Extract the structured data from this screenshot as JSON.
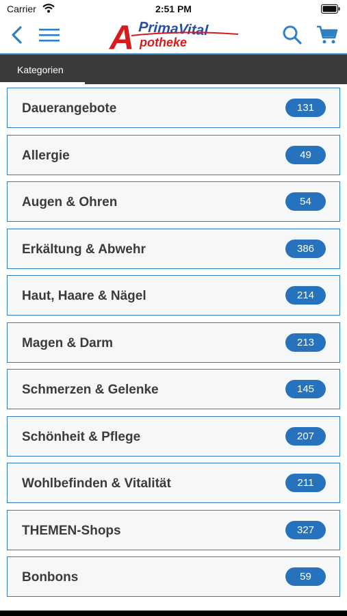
{
  "status_bar": {
    "carrier": "Carrier",
    "time": "2:51 PM"
  },
  "header": {
    "logo_brand": "PrimaVital",
    "logo_initial": "A",
    "logo_sub": "potheke",
    "icons": [
      "back-icon",
      "menu-icon",
      "search-icon",
      "cart-icon"
    ],
    "accent_color": "#2e7fc4",
    "logo_red": "#d41c1c",
    "logo_blue": "#2b4fa8"
  },
  "tabbar": {
    "active_tab": "Kategorien"
  },
  "categories": [
    {
      "label": "Dauerangebote",
      "count": "131"
    },
    {
      "label": "Allergie",
      "count": "49"
    },
    {
      "label": "Augen & Ohren",
      "count": "54"
    },
    {
      "label": "Erkältung & Abwehr",
      "count": "386"
    },
    {
      "label": "Haut, Haare & Nägel",
      "count": "214"
    },
    {
      "label": "Magen & Darm",
      "count": "213"
    },
    {
      "label": "Schmerzen & Gelenke",
      "count": "145"
    },
    {
      "label": "Schönheit & Pflege",
      "count": "207"
    },
    {
      "label": "Wohlbefinden & Vitalität",
      "count": "211"
    },
    {
      "label": "THEMEN-Shops",
      "count": "327"
    },
    {
      "label": "Bonbons",
      "count": "59"
    }
  ]
}
